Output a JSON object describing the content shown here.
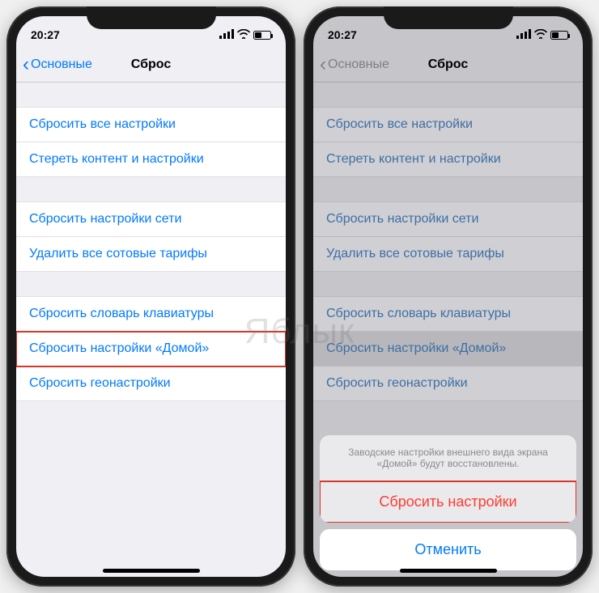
{
  "watermark": "Яблык",
  "left": {
    "time": "20:27",
    "back_label": "Основные",
    "title": "Сброс",
    "group1": [
      {
        "label": "Сбросить все настройки"
      },
      {
        "label": "Стереть контент и настройки"
      }
    ],
    "group2": [
      {
        "label": "Сбросить настройки сети"
      },
      {
        "label": "Удалить все сотовые тарифы"
      }
    ],
    "group3": [
      {
        "label": "Сбросить словарь клавиатуры"
      },
      {
        "label": "Сбросить настройки «Домой»",
        "highlighted": true
      },
      {
        "label": "Сбросить геонастройки"
      }
    ]
  },
  "right": {
    "time": "20:27",
    "back_label": "Основные",
    "title": "Сброс",
    "group1": [
      {
        "label": "Сбросить все настройки"
      },
      {
        "label": "Стереть контент и настройки"
      }
    ],
    "group2": [
      {
        "label": "Сбросить настройки сети"
      },
      {
        "label": "Удалить все сотовые тарифы"
      }
    ],
    "group3": [
      {
        "label": "Сбросить словарь клавиатуры"
      },
      {
        "label": "Сбросить настройки «Домой»",
        "highlighted": true
      },
      {
        "label": "Сбросить геонастройки"
      }
    ],
    "sheet": {
      "message": "Заводские настройки внешнего вида экрана «Домой» будут восстановлены.",
      "confirm": "Сбросить настройки",
      "cancel": "Отменить"
    }
  }
}
